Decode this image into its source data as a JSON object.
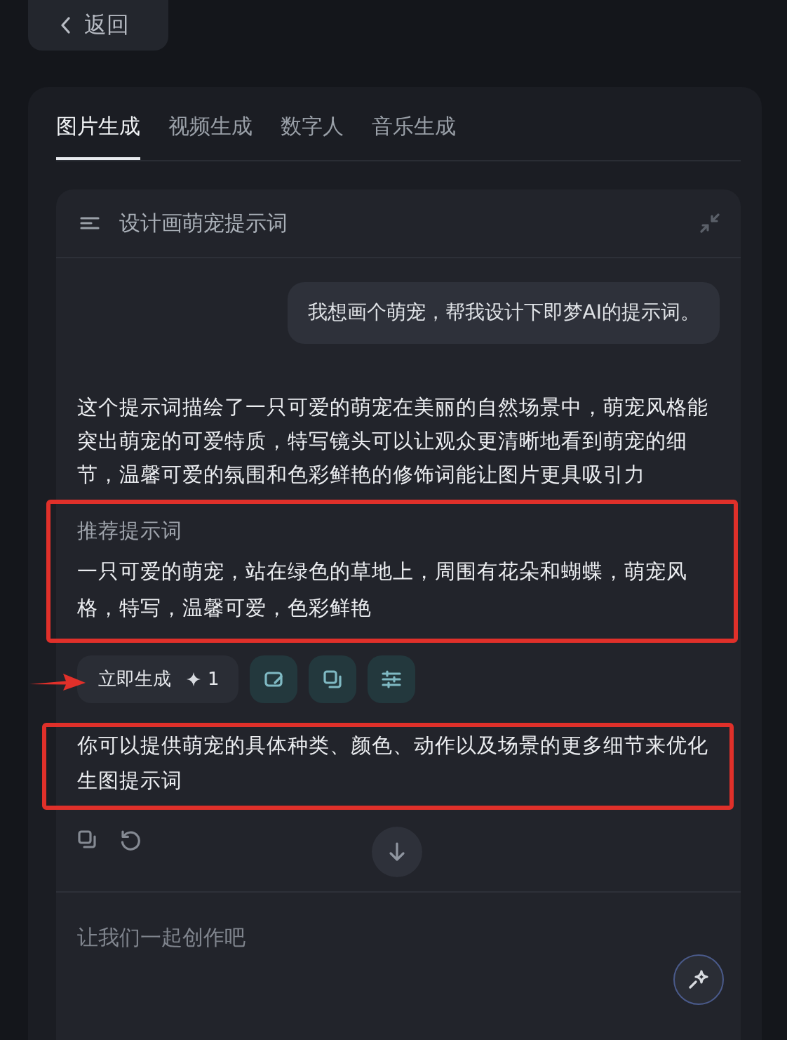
{
  "back_button": {
    "label": "返回"
  },
  "tabs": [
    {
      "label": "图片生成",
      "selected": true
    },
    {
      "label": "视频生成",
      "selected": false
    },
    {
      "label": "数字人",
      "selected": false
    },
    {
      "label": "音乐生成",
      "selected": false
    }
  ],
  "conversation": {
    "title": "设计画萌宠提示词",
    "user_message": "我想画个萌宠，帮我设计下即梦AI的提示词。",
    "answer": "这个提示词描绘了一只可爱的萌宠在美丽的自然场景中，萌宠风格能突出萌宠的可爱特质，特写镜头可以让观众更清晰地看到萌宠的细节，温馨可爱的氛围和色彩鲜艳的修饰词能让图片更具吸引力",
    "recommendation": {
      "heading": "推荐提示词",
      "text": "一只可爱的萌宠，站在绿色的草地上，周围有花朵和蝴蝶，萌宠风格，特写，温馨可爱，色彩鲜艳",
      "highlighted": true
    },
    "actions": [
      {
        "kind": "generate",
        "label": "立即生成",
        "cost": "1",
        "pointed": true
      },
      {
        "kind": "edit"
      },
      {
        "kind": "duplicate"
      },
      {
        "kind": "adjust"
      }
    ],
    "tip": {
      "text": "你可以提供萌宠的具体种类、颜色、动作以及场景的更多细节来优化生图提示词",
      "highlighted": true
    }
  },
  "input": {
    "placeholder": "让我们一起创作吧"
  }
}
